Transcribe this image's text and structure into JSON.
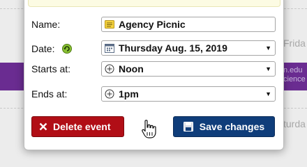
{
  "background": {
    "day_right_top": "Frida",
    "day_right_bottom": "turda",
    "link_line_1": "n.edu",
    "link_line_2": "cience",
    "band_color": "#6a2c91"
  },
  "form": {
    "name": {
      "label": "Name:",
      "value": "Agency Picnic",
      "icon": "note-icon"
    },
    "date": {
      "label": "Date:",
      "value": "Thursday Aug. 15, 2019",
      "icon": "calendar-icon",
      "label_icon": "recurring-arrow-icon"
    },
    "starts": {
      "label": "Starts at:",
      "value": "Noon",
      "icon": "clock-icon"
    },
    "ends": {
      "label": "Ends at:",
      "value": "1pm",
      "icon": "clock-icon"
    }
  },
  "actions": {
    "delete_label": "Delete event",
    "delete_color": "#b10e16",
    "save_label": "Save changes",
    "save_color": "#0f3d7a"
  }
}
